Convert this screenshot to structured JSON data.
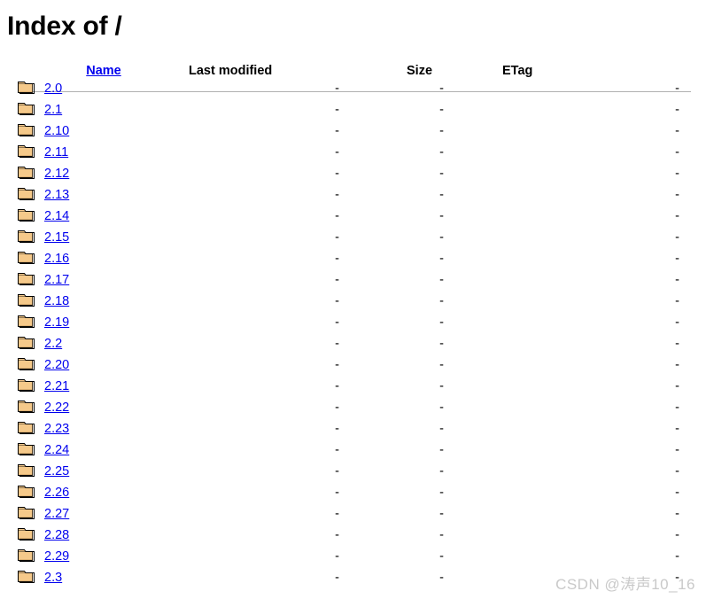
{
  "page": {
    "title": "Index of /",
    "path": "/"
  },
  "icons": {
    "folder": "folder-icon"
  },
  "colors": {
    "link": "#0000ee",
    "rule": "#b0b0b0",
    "folder_fill": "#f5c98a",
    "folder_outline": "#000000",
    "watermark": "#c9c9c9",
    "text": "#000000"
  },
  "table": {
    "headers": {
      "name": "Name",
      "last_modified": "Last modified",
      "size": "Size",
      "etag": "ETag"
    },
    "empty_value": "-",
    "rows": [
      {
        "name": "2.0",
        "last_modified": "-",
        "size": "-",
        "etag": "-"
      },
      {
        "name": "2.1",
        "last_modified": "-",
        "size": "-",
        "etag": "-"
      },
      {
        "name": "2.10",
        "last_modified": "-",
        "size": "-",
        "etag": "-"
      },
      {
        "name": "2.11",
        "last_modified": "-",
        "size": "-",
        "etag": "-"
      },
      {
        "name": "2.12",
        "last_modified": "-",
        "size": "-",
        "etag": "-"
      },
      {
        "name": "2.13",
        "last_modified": "-",
        "size": "-",
        "etag": "-"
      },
      {
        "name": "2.14",
        "last_modified": "-",
        "size": "-",
        "etag": "-"
      },
      {
        "name": "2.15",
        "last_modified": "-",
        "size": "-",
        "etag": "-"
      },
      {
        "name": "2.16",
        "last_modified": "-",
        "size": "-",
        "etag": "-"
      },
      {
        "name": "2.17",
        "last_modified": "-",
        "size": "-",
        "etag": "-"
      },
      {
        "name": "2.18",
        "last_modified": "-",
        "size": "-",
        "etag": "-"
      },
      {
        "name": "2.19",
        "last_modified": "-",
        "size": "-",
        "etag": "-"
      },
      {
        "name": "2.2",
        "last_modified": "-",
        "size": "-",
        "etag": "-"
      },
      {
        "name": "2.20",
        "last_modified": "-",
        "size": "-",
        "etag": "-"
      },
      {
        "name": "2.21",
        "last_modified": "-",
        "size": "-",
        "etag": "-"
      },
      {
        "name": "2.22",
        "last_modified": "-",
        "size": "-",
        "etag": "-"
      },
      {
        "name": "2.23",
        "last_modified": "-",
        "size": "-",
        "etag": "-"
      },
      {
        "name": "2.24",
        "last_modified": "-",
        "size": "-",
        "etag": "-"
      },
      {
        "name": "2.25",
        "last_modified": "-",
        "size": "-",
        "etag": "-"
      },
      {
        "name": "2.26",
        "last_modified": "-",
        "size": "-",
        "etag": "-"
      },
      {
        "name": "2.27",
        "last_modified": "-",
        "size": "-",
        "etag": "-"
      },
      {
        "name": "2.28",
        "last_modified": "-",
        "size": "-",
        "etag": "-"
      },
      {
        "name": "2.29",
        "last_modified": "-",
        "size": "-",
        "etag": "-"
      },
      {
        "name": "2.3",
        "last_modified": "-",
        "size": "-",
        "etag": "-"
      }
    ]
  },
  "watermark": {
    "text": "CSDN @涛声10_16"
  }
}
